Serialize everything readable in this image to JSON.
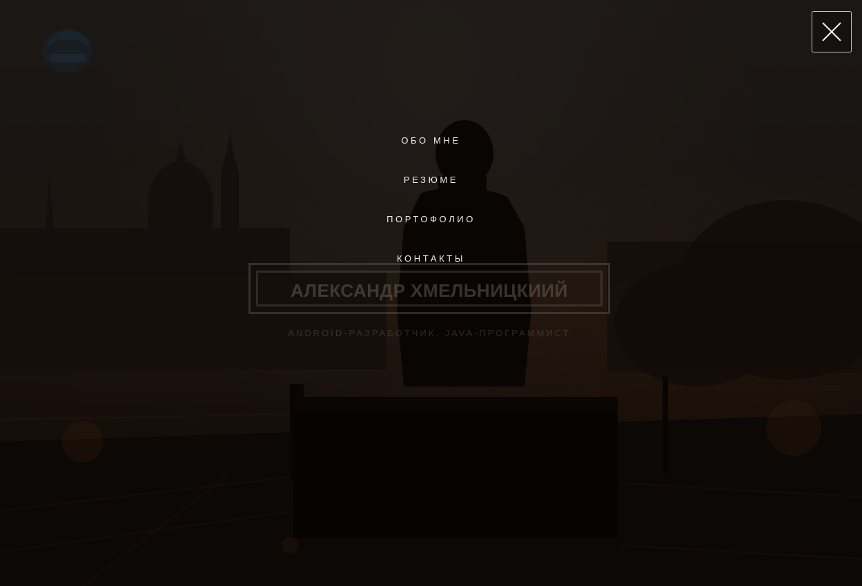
{
  "hero": {
    "title": "АЛЕКСАНДР ХМЕЛЬНИЦКИИЙ",
    "subtitle": "ANDROID-РАЗРАБОТЧИК, JAVA-ПРОГРАММИСТ"
  },
  "menu": {
    "items": [
      {
        "label": "ОБО МНЕ"
      },
      {
        "label": "РЕЗЮМЕ"
      },
      {
        "label": "ПОРТОФОЛИО"
      },
      {
        "label": "КОНТАКТЫ"
      }
    ]
  },
  "close": {
    "icon": "close-icon"
  },
  "logo": {
    "icon": "logo-icon"
  },
  "colors": {
    "menu_text": "#ececec",
    "close_border": "#cfcfcf",
    "background": "#1a1410"
  }
}
